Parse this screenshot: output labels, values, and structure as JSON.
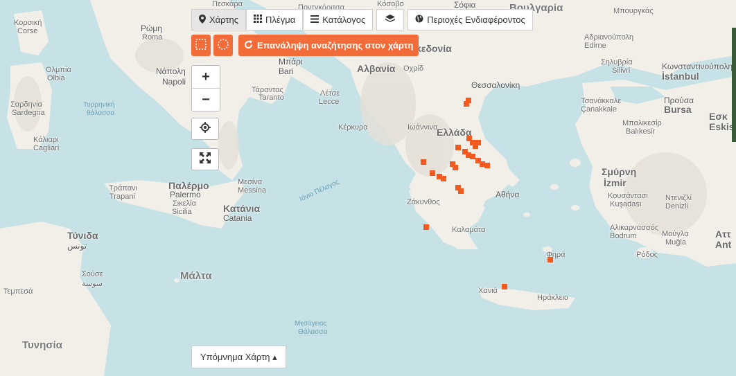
{
  "toolbar": {
    "map_label": "Χάρτης",
    "grid_label": "Πλέγμα",
    "list_label": "Κατάλογος",
    "areas_label": "Περιοχές Ενδιαφέροντος"
  },
  "search_controls": {
    "repeat_search_label": "Επανάληψη αναζήτησης στον χάρτη"
  },
  "zoom": {
    "in": "+",
    "out": "−"
  },
  "legend": {
    "label": "Υπόμνημα Χάρτη ▴"
  },
  "colors": {
    "accent": "#f26c3a",
    "marker": "#f25a1f",
    "sea": "#c7e2e6",
    "land": "#f2efe9"
  },
  "icons": {
    "map": "map-pin-icon",
    "grid": "grid-icon",
    "list": "list-icon",
    "layers": "layers-icon",
    "globe": "globe-icon",
    "rectangle_select": "rectangle-select-icon",
    "circle_select": "circle-select-icon",
    "refresh": "refresh-icon",
    "locate": "locate-icon",
    "fullscreen": "fullscreen-icon"
  },
  "map_labels": {
    "pescara": "Πεσκάρα",
    "roma": "Ρώμη",
    "roma_local": "Roma",
    "napoli": "Νάπολη",
    "napoli_local": "Napoli",
    "bari": "Μπάρι",
    "bari_local": "Bari",
    "taranto": "Τάραντας",
    "taranto_local": "Taranto",
    "lecce": "Λέτσε",
    "lecce_local": "Lecce",
    "corsica": "Κορσική",
    "corsica_local": "Corse",
    "olbia": "Ολμπία",
    "olbia_local": "Olbia",
    "sardinia": "Σαρδηνία",
    "sardinia_local": "Sardegna",
    "cagliari": "Κάλιαρι",
    "cagliari_local": "Cagliari",
    "tyrrhenian": "Τυρρηνική",
    "tyrrhenian_2": "θάλασσα",
    "palermo": "Παλέρμο",
    "palermo_local": "Palermo",
    "trapani": "Τράπανι",
    "trapani_local": "Trapani",
    "messina": "Μεσίνα",
    "messina_local": "Messina",
    "sicily": "Σικελία",
    "sicily_local": "Sicilia",
    "catania": "Κατάνια",
    "catania_local": "Catania",
    "ionian": "Ιόνιο Πέλαγος",
    "malta": "Μάλτα",
    "tunis": "Τύνιδα",
    "tunis_local": "تونس",
    "sousse": "Σούσε",
    "sousse_local": "سوسة",
    "tunisia": "Τυνησία",
    "tempesa": "Τεμπεσά",
    "mediterranean": "Μεσόγειος",
    "mediterranean_2": "Θάλασσα",
    "albania": "Αλβανία",
    "macedonia": "κεδονία",
    "ohrid": "Οχρίδ",
    "podgorica": "Ποντγκόριτσα",
    "kosovo": "Κόσοβο",
    "sofia": "Σόφια",
    "bulgaria": "Βουλγαρία",
    "burgas": "Μπουργκάς",
    "greece": "Ελλάδα",
    "thessaloniki": "Θεσσαλονίκη",
    "kerkyra": "Κέρκυρα",
    "ioannina": "Ιωάννινα",
    "athens": "Αθήνα",
    "zakynthos": "Ζάκυνθος",
    "kalamata": "Καλαμάτα",
    "chania": "Χανιά",
    "heraklion": "Ηράκλειο",
    "rhodes": "Ρόδος",
    "fira": "Φηρά",
    "edirne_gr": "Αδριανούπολη",
    "edirne": "Edirne",
    "silivri_gr": "Σηλυβρία",
    "silivri": "Silivri",
    "istanbul_gr": "Κωνσταντινούπολη",
    "istanbul": "İstanbul",
    "canakkale_gr": "Τσανάκκαλε",
    "canakkale": "Çanakkale",
    "bursa_gr": "Προύσα",
    "bursa": "Bursa",
    "balikesir_gr": "Μπαλικεσίρ",
    "balikesir": "Balıkesir",
    "eskisehir_gr": "Εσκ",
    "eskisehir": "Eskis",
    "izmir_gr": "Σμύρνη",
    "izmir": "İzmir",
    "kusadasi_gr": "Κουσάντασι",
    "kusadasi": "Kuşadası",
    "denizli_gr": "Ντενιζλί",
    "denizli": "Denizli",
    "bodrum_gr": "Αλικαρνασσός",
    "bodrum": "Bodrum",
    "mugla_gr": "Μούγλα",
    "mugla": "Muğla",
    "antalya_gr": "Αττ",
    "antalya": "Ant",
    "macedonia_n": "Μακεδονία"
  },
  "markers": [
    {
      "lon": 22.96,
      "lat": 40.62
    },
    {
      "lon": 22.88,
      "lat": 40.52
    },
    {
      "lon": 22.98,
      "lat": 39.55
    },
    {
      "lon": 23.1,
      "lat": 39.45
    },
    {
      "lon": 23.3,
      "lat": 39.45
    },
    {
      "lon": 23.2,
      "lat": 39.35
    },
    {
      "lon": 22.6,
      "lat": 39.3
    },
    {
      "lon": 22.85,
      "lat": 39.2
    },
    {
      "lon": 22.95,
      "lat": 39.1
    },
    {
      "lon": 23.1,
      "lat": 39.05
    },
    {
      "lon": 23.3,
      "lat": 38.95
    },
    {
      "lon": 23.45,
      "lat": 38.85
    },
    {
      "lon": 23.6,
      "lat": 38.8
    },
    {
      "lon": 22.4,
      "lat": 38.85
    },
    {
      "lon": 22.5,
      "lat": 38.75
    },
    {
      "lon": 21.4,
      "lat": 38.9
    },
    {
      "lon": 21.7,
      "lat": 38.6
    },
    {
      "lon": 21.95,
      "lat": 38.5
    },
    {
      "lon": 22.1,
      "lat": 38.45
    },
    {
      "lon": 22.6,
      "lat": 38.2
    },
    {
      "lon": 22.7,
      "lat": 38.1
    },
    {
      "lon": 21.5,
      "lat": 37.1
    },
    {
      "lon": 25.8,
      "lat": 36.2
    },
    {
      "lon": 24.2,
      "lat": 35.45
    }
  ]
}
